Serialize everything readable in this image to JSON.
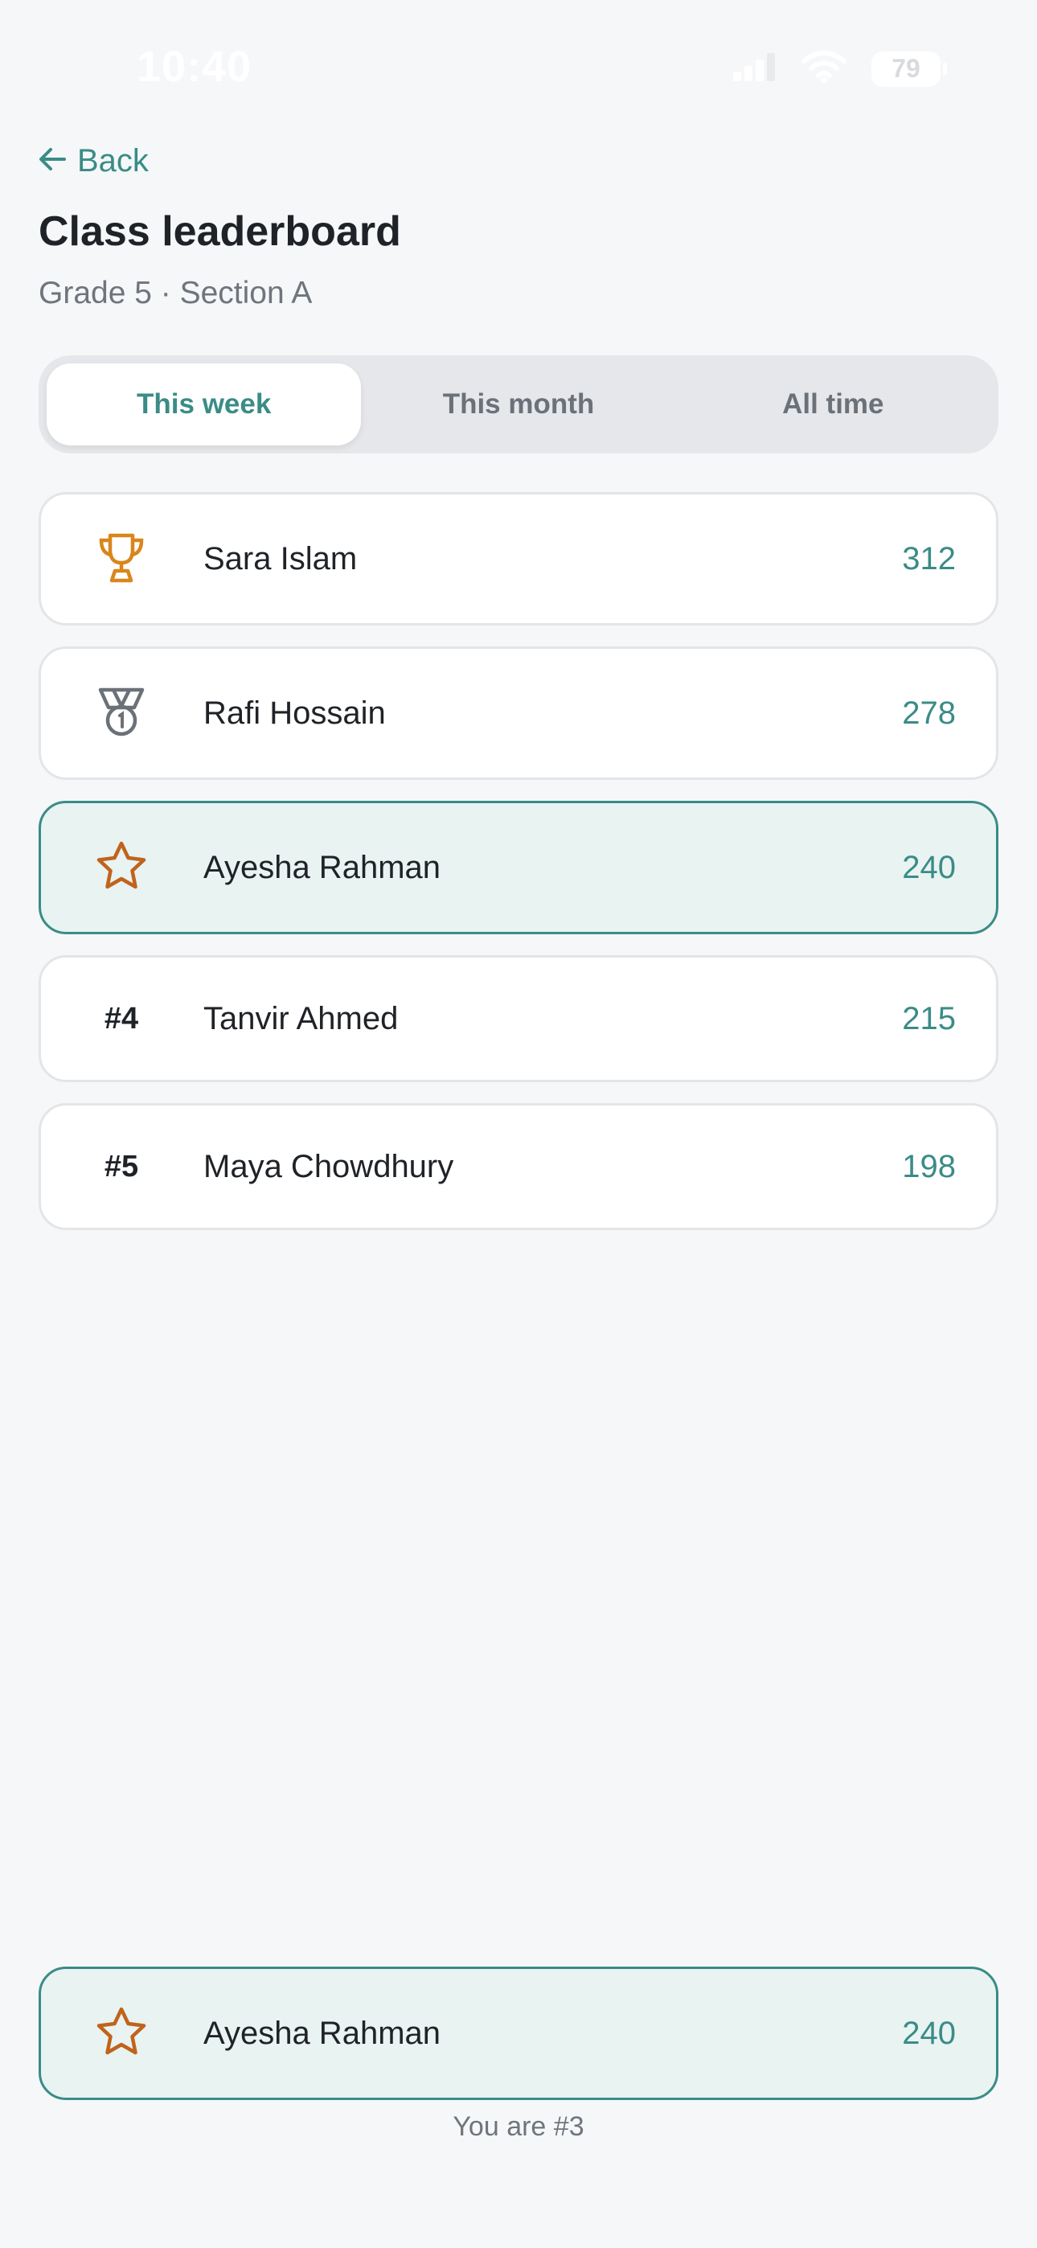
{
  "status_bar": {
    "time": "10:40",
    "battery": "79"
  },
  "nav": {
    "back_label": "Back"
  },
  "header": {
    "title": "Class leaderboard",
    "subtitle": "Grade 5 · Section A"
  },
  "tabs": [
    {
      "label": "This week",
      "active": true
    },
    {
      "label": "This month",
      "active": false
    },
    {
      "label": "All time",
      "active": false
    }
  ],
  "leaderboard": [
    {
      "rank_icon": "trophy-icon",
      "rank_label": "",
      "name": "Sara Islam",
      "score": "312"
    },
    {
      "rank_icon": "medal-icon",
      "rank_label": "",
      "name": "Rafi Hossain",
      "score": "278"
    },
    {
      "rank_icon": "star-icon",
      "rank_label": "",
      "name": "Ayesha Rahman",
      "score": "240",
      "highlight": true
    },
    {
      "rank_icon": "",
      "rank_label": "#4",
      "name": "Tanvir Ahmed",
      "score": "215"
    },
    {
      "rank_icon": "",
      "rank_label": "#5",
      "name": "Maya Chowdhury",
      "score": "198"
    }
  ],
  "my_rank": {
    "rank_icon": "star-icon",
    "name": "Ayesha Rahman",
    "score": "240",
    "note": "You are #3"
  },
  "colors": {
    "accent": "#3a8c86",
    "trophy": "#d9861a",
    "medal": "#6b7178",
    "star": "#c0631b",
    "highlight_bg": "#e8f3f2"
  }
}
